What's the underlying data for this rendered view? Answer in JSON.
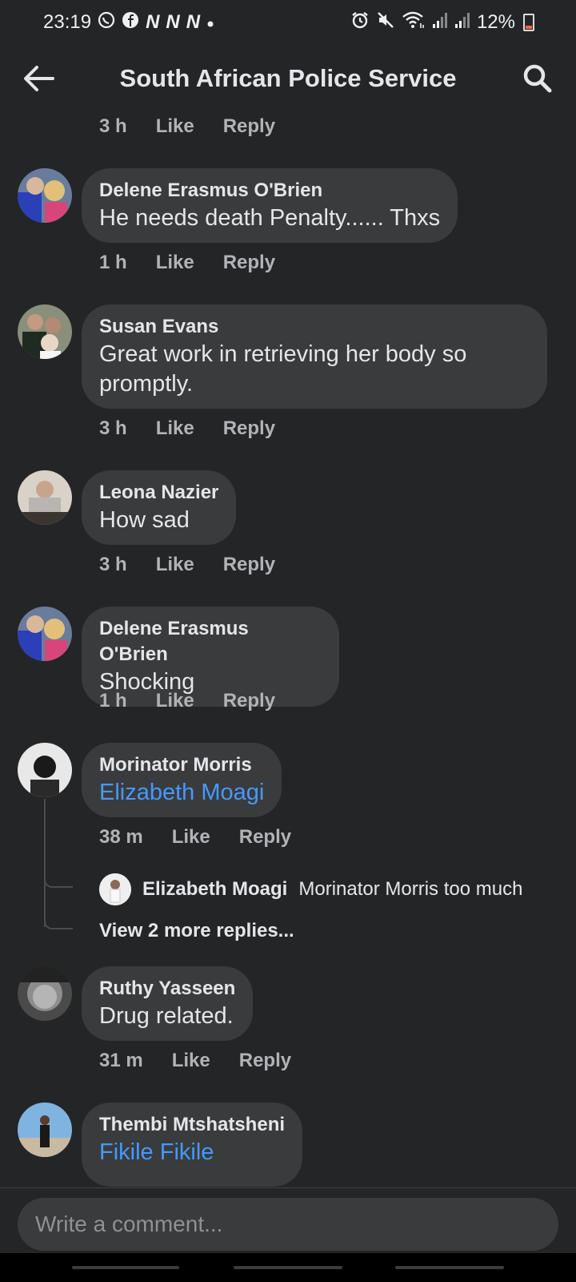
{
  "status_bar": {
    "time": "23:19",
    "battery": "12%",
    "icons": [
      "whatsapp-icon",
      "facebook-icon",
      "n-icon",
      "n-icon",
      "n-icon",
      "dot-icon",
      "alarm-icon",
      "mute-icon",
      "wifi-icon",
      "signal-icon",
      "signal-icon",
      "battery-icon"
    ]
  },
  "header": {
    "title": "South African Police Service",
    "back_icon": "back-arrow-icon",
    "search_icon": "search-icon"
  },
  "top_meta": {
    "time": "3 h",
    "like": "Like",
    "reply": "Reply"
  },
  "comments": [
    {
      "name": "Delene Erasmus O'Brien",
      "text": "He needs death Penalty...... Thxs",
      "time": "1 h",
      "like": "Like",
      "reply": "Reply"
    },
    {
      "name": "Susan Evans",
      "text_line1": "Great work in retrieving her body so",
      "text_line2": "promptly.",
      "time": "3 h",
      "like": "Like",
      "reply": "Reply"
    },
    {
      "name": "Leona Nazier",
      "text": "How sad",
      "time": "3 h",
      "like": "Like",
      "reply": "Reply"
    },
    {
      "name": "Delene Erasmus O'Brien",
      "text": "Shocking",
      "time": "1 h",
      "like": "Like",
      "reply": "Reply"
    },
    {
      "name": "Morinator Morris",
      "mention": "Elizabeth Moagi",
      "time": "38 m",
      "like": "Like",
      "reply": "Reply",
      "nested_reply": {
        "name": "Elizabeth Moagi",
        "text": "Morinator Morris too much"
      },
      "view_more": "View 2 more replies..."
    },
    {
      "name": "Ruthy Yasseen",
      "text": "Drug related.",
      "time": "31 m",
      "like": "Like",
      "reply": "Reply"
    },
    {
      "name": "Thembi Mtshatsheni",
      "mention": "Fikile Fikile"
    }
  ],
  "composer": {
    "placeholder": "Write a comment..."
  },
  "colors": {
    "background": "#242526",
    "bubble": "#3a3b3c",
    "mention": "#4599ff",
    "meta": "#b0b3b8"
  }
}
